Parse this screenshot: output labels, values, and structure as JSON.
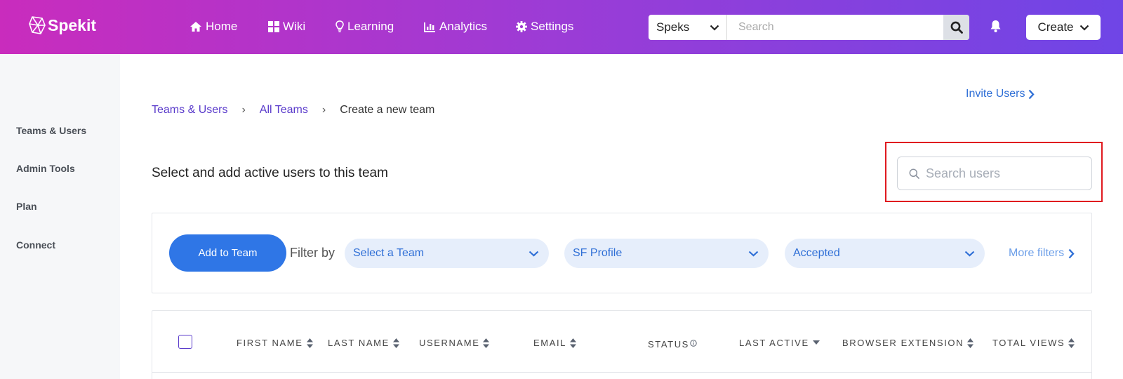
{
  "brand": {
    "name": "Spekit"
  },
  "nav": [
    {
      "label": "Home",
      "icon": "home-icon"
    },
    {
      "label": "Wiki",
      "icon": "grid-icon"
    },
    {
      "label": "Learning",
      "icon": "lightbulb-icon"
    },
    {
      "label": "Analytics",
      "icon": "bar-chart-icon"
    },
    {
      "label": "Settings",
      "icon": "gear-icon"
    }
  ],
  "topbar": {
    "scope_select": "Speks",
    "search_placeholder": "Search",
    "create_label": "Create"
  },
  "sidebar": {
    "items": [
      {
        "label": "Teams & Users"
      },
      {
        "label": "Admin Tools"
      },
      {
        "label": "Plan"
      },
      {
        "label": "Connect"
      }
    ]
  },
  "invite_label": "Invite Users",
  "breadcrumb": {
    "items": [
      {
        "label": "Teams & Users"
      },
      {
        "label": "All Teams"
      },
      {
        "label": "Create a new team"
      }
    ],
    "separator": "›"
  },
  "heading": "Select and add active users to this team",
  "user_search": {
    "placeholder": "Search users"
  },
  "filters": {
    "add_button": "Add to Team",
    "label": "Filter by",
    "dropdowns": [
      {
        "value": "Select a Team"
      },
      {
        "value": "SF Profile"
      },
      {
        "value": "Accepted"
      }
    ],
    "more": "More filters"
  },
  "table": {
    "columns": [
      {
        "label": "FIRST NAME",
        "sort": "both"
      },
      {
        "label": "LAST NAME",
        "sort": "both"
      },
      {
        "label": "USERNAME",
        "sort": "both"
      },
      {
        "label": "EMAIL",
        "sort": "both"
      },
      {
        "label": "STATUS",
        "sort": "info"
      },
      {
        "label": "LAST ACTIVE",
        "sort": "desc"
      },
      {
        "label": "BROWSER EXTENSION",
        "sort": "both"
      },
      {
        "label": "TOTAL VIEWS",
        "sort": "both"
      }
    ]
  },
  "colors": {
    "header_gradient": [
      "#c92cbd",
      "#6f45e6"
    ],
    "primary": "#2f76e6",
    "link": "#5a3bcb",
    "highlight": "#e0191f"
  }
}
